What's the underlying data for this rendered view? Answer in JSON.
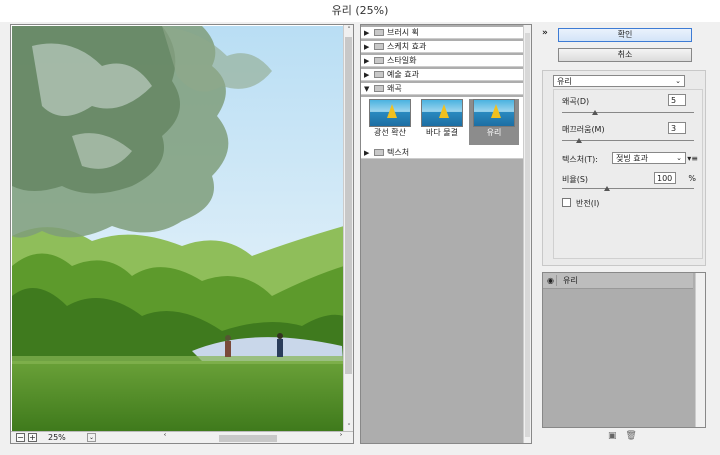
{
  "window": {
    "title": "유리 (25%)"
  },
  "preview": {
    "zoom": "25%",
    "zoom_out": "−",
    "zoom_in": "+",
    "dropdown": "⌄",
    "scroll_up": "˄",
    "scroll_down": "˅",
    "scroll_left": "˂",
    "scroll_right": "˃"
  },
  "gallery": {
    "categories": [
      {
        "label": "브러시 획",
        "expanded": false
      },
      {
        "label": "스케치 효과",
        "expanded": false
      },
      {
        "label": "스타일화",
        "expanded": false
      },
      {
        "label": "예술 효과",
        "expanded": false
      },
      {
        "label": "왜곡",
        "expanded": true
      },
      {
        "label": "텍스처",
        "expanded": false
      }
    ],
    "distort_filters": [
      {
        "label": "광선 확산",
        "selected": false
      },
      {
        "label": "바다 물결",
        "selected": false
      },
      {
        "label": "유리",
        "selected": true
      }
    ],
    "collapsed_marker": "▶",
    "expanded_marker": "▼"
  },
  "panel": {
    "collapse_icon": "»",
    "ok_label": "확인",
    "cancel_label": "취소",
    "filter": "유리",
    "params": {
      "distortion_label": "왜곡(D)",
      "distortion_value": "5",
      "distortion_level": 0.25,
      "smoothness_label": "매끄러움(M)",
      "smoothness_value": "3",
      "smoothness_level": 0.13,
      "texture_label": "텍스처(T):",
      "texture_value": "젖빙 효과",
      "texture_menu": "▾≡",
      "scale_label": "비율(S)",
      "scale_value": "100",
      "scale_unit": "%",
      "scale_level": 0.34,
      "invert_label": "반전(I)",
      "invert_checked": false
    },
    "dropdown_arrow": "⌄"
  },
  "layers": {
    "items": [
      {
        "name": "유리",
        "visible": true
      }
    ],
    "eye": "◉",
    "new_icon": "▣",
    "delete_icon": "🗑"
  }
}
